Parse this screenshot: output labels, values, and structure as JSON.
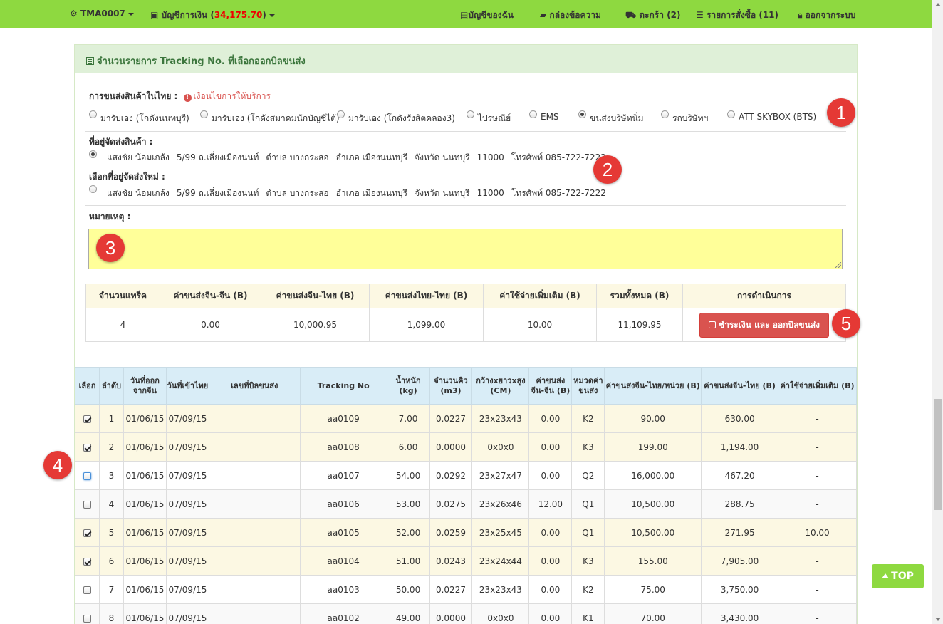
{
  "nav": {
    "user": "TMA0007",
    "wallet_label": "บัญชีการเงิน",
    "wallet_balance": "34,175.70",
    "my_account": "บัญชีของฉัน",
    "inbox": "กล่องข้อความ",
    "cart": "ตะกร้า (2)",
    "orders": "รายการสั่งซื้อ (11)",
    "logout": "ออกจากระบบ"
  },
  "panel": {
    "title": "จำนวนรายการ Tracking No. ที่เลือกออกบิลขนส่ง"
  },
  "shipping": {
    "label": "การขนส่งสินค้าในไทย :",
    "terms_link": "เงื่อนไขการให้บริการ",
    "options": [
      {
        "label": "มารับเอง (โกดังนนทบุรี)",
        "checked": false
      },
      {
        "label": "มารับเอง (โกดังสมาคมนักบัญชีไต้)",
        "checked": false
      },
      {
        "label": "มารับเอง (โกดังรังสิตคลอง3)",
        "checked": false
      },
      {
        "label": "ไปรษณีย์",
        "checked": false
      },
      {
        "label": "EMS",
        "checked": false
      },
      {
        "label": "ขนส่งบริษัทนิ่ม",
        "checked": true
      },
      {
        "label": "รถบริษัทฯ",
        "checked": false
      },
      {
        "label": "ATT SKYBOX (BTS)",
        "checked": false
      }
    ]
  },
  "address": {
    "label": "ที่อยู่จัดส่งสินค้า :",
    "new_label": "เลือกที่อยู่จัดส่งใหม่ :",
    "current": [
      "แสงชัย น้อมเกล้ง",
      "5/99 ถ.เลี่ยงเมืองนนท์",
      "ตำบล บางกระสอ",
      "อำเภอ เมืองนนทบุรี",
      "จังหวัด นนทบุรี",
      "11000",
      "โทรศัพท์ 085-722-7222"
    ],
    "alternate": [
      "แสงชัย น้อมเกล้ง",
      "5/99 ถ.เลี่ยงเมืองนนท์",
      "ตำบล บางกระสอ",
      "อำเภอ เมืองนนทบุรี",
      "จังหวัด นนทบุรี",
      "11000",
      "โทรศัพท์ 085-722-7222"
    ]
  },
  "note": {
    "label": "หมายเหตุ :",
    "value": ""
  },
  "summary": {
    "headers": [
      "จำนวนแทร็ค",
      "ค่าขนส่งจีน-จีน (B)",
      "ค่าขนส่งจีน-ไทย (B)",
      "ค่าขนส่งไทย-ไทย (B)",
      "ค่าใช้จ่ายเพิ่มเติม (B)",
      "รวมทั้งหมด (B)",
      "การดำเนินการ"
    ],
    "values": [
      "4",
      "0.00",
      "10,000.95",
      "1,099.00",
      "10.00",
      "11,109.95"
    ],
    "pay_button": "ชำระเงิน และ ออกบิลขนส่ง"
  },
  "table": {
    "headers": [
      "เลือก",
      "ลำดับ",
      "วันที่ออกจากจีน",
      "วันที่เข้าไทย",
      "เลขที่บิลขนส่ง",
      "Tracking No",
      "น้ำหนัก (kg)",
      "จำนวนคิว (m3)",
      "กว้างxยาวxสูง (CM)",
      "ค่าขนส่งจีน-จีน (B)",
      "หมวดค่าขนส่ง",
      "ค่าขนส่งจีน-ไทย/หน่วย (B)",
      "ค่าขนส่งจีน-ไทย (B)",
      "ค่าใช้จ่ายเพิ่มเติม (B)"
    ],
    "rows": [
      {
        "checked": true,
        "no": "1",
        "out": "01/06/15",
        "in": "07/09/15",
        "bill": "",
        "tracking": "aa0109",
        "kg": "7.00",
        "m3": "0.0227",
        "dim": "23x23x43",
        "cncn": "0.00",
        "cat": "K2",
        "unit": "90.00",
        "cnth": "630.00",
        "extra": "-"
      },
      {
        "checked": true,
        "no": "2",
        "out": "01/06/15",
        "in": "07/09/15",
        "bill": "",
        "tracking": "aa0108",
        "kg": "6.00",
        "m3": "0.0000",
        "dim": "0x0x0",
        "cncn": "0.00",
        "cat": "K3",
        "unit": "199.00",
        "cnth": "1,194.00",
        "extra": "-"
      },
      {
        "checked": false,
        "no": "3",
        "out": "01/06/15",
        "in": "07/09/15",
        "bill": "",
        "tracking": "aa0107",
        "kg": "54.00",
        "m3": "0.0292",
        "dim": "23x27x47",
        "cncn": "0.00",
        "cat": "Q2",
        "unit": "16,000.00",
        "cnth": "467.20",
        "extra": "-"
      },
      {
        "checked": false,
        "no": "4",
        "out": "01/06/15",
        "in": "07/09/15",
        "bill": "",
        "tracking": "aa0106",
        "kg": "53.00",
        "m3": "0.0275",
        "dim": "23x26x46",
        "cncn": "12.00",
        "cat": "Q1",
        "unit": "10,500.00",
        "cnth": "288.75",
        "extra": "-"
      },
      {
        "checked": true,
        "no": "5",
        "out": "01/06/15",
        "in": "07/09/15",
        "bill": "",
        "tracking": "aa0105",
        "kg": "52.00",
        "m3": "0.0259",
        "dim": "23x25x45",
        "cncn": "0.00",
        "cat": "Q1",
        "unit": "10,500.00",
        "cnth": "271.95",
        "extra": "10.00"
      },
      {
        "checked": true,
        "no": "6",
        "out": "01/06/15",
        "in": "07/09/15",
        "bill": "",
        "tracking": "aa0104",
        "kg": "51.00",
        "m3": "0.0243",
        "dim": "23x24x44",
        "cncn": "0.00",
        "cat": "K3",
        "unit": "155.00",
        "cnth": "7,905.00",
        "extra": "-"
      },
      {
        "checked": false,
        "no": "7",
        "out": "01/06/15",
        "in": "07/09/15",
        "bill": "",
        "tracking": "aa0103",
        "kg": "50.00",
        "m3": "0.0227",
        "dim": "23x23x43",
        "cncn": "0.00",
        "cat": "K2",
        "unit": "75.00",
        "cnth": "3,750.00",
        "extra": "-"
      },
      {
        "checked": false,
        "no": "8",
        "out": "01/06/15",
        "in": "07/09/15",
        "bill": "",
        "tracking": "aa0102",
        "kg": "49.00",
        "m3": "0.0000",
        "dim": "0x0x0",
        "cncn": "0.00",
        "cat": "K1",
        "unit": "70.00",
        "cnth": "3,430.00",
        "extra": "-"
      }
    ]
  },
  "badges": [
    "1",
    "2",
    "3",
    "4",
    "5"
  ],
  "top_button": "TOP",
  "colors": {
    "nav": "#8ed940",
    "panel_heading": "#dff0d8",
    "accent_red": "#e00000",
    "badge": "#e53935",
    "selected_row": "#fcf8e3"
  }
}
